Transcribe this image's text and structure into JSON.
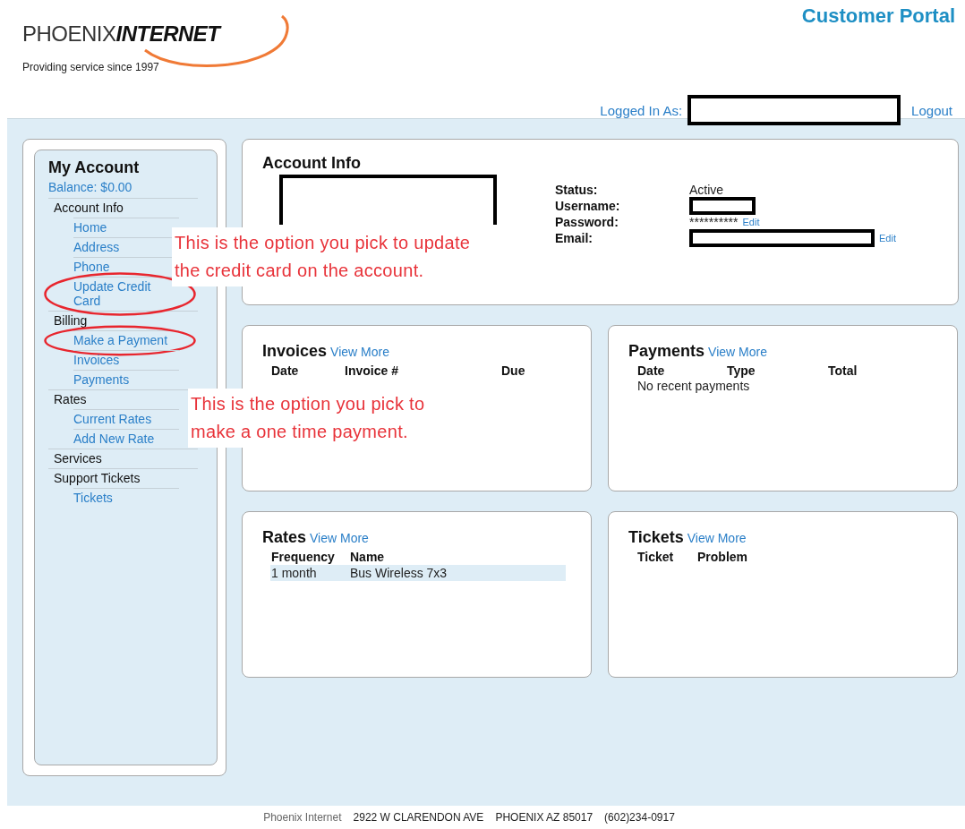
{
  "header": {
    "brand_light": "PHOENIX",
    "brand_bold": "INTERNET",
    "tagline": "Providing service since 1997",
    "portal_title": "Customer Portal"
  },
  "login": {
    "label": "Logged In As:",
    "logout": "Logout"
  },
  "sidebar": {
    "title": "My Account",
    "balance": "Balance: $0.00",
    "sections": [
      {
        "label": "Account Info",
        "children": [
          {
            "label": "Home",
            "circled": false
          },
          {
            "label": "Address",
            "circled": false
          },
          {
            "label": "Phone",
            "circled": false
          },
          {
            "label": "Update Credit Card",
            "circled": true
          }
        ]
      },
      {
        "label": "Billing",
        "children": [
          {
            "label": "Make a Payment",
            "circled": true
          },
          {
            "label": "Invoices",
            "circled": false
          },
          {
            "label": "Payments",
            "circled": false
          }
        ]
      },
      {
        "label": "Rates",
        "children": [
          {
            "label": "Current Rates",
            "circled": false
          },
          {
            "label": "Add New Rate",
            "circled": false
          }
        ]
      },
      {
        "label": "Services"
      },
      {
        "label": "Support Tickets",
        "children": [
          {
            "label": "Tickets",
            "circled": false
          }
        ]
      }
    ]
  },
  "account_info": {
    "title": "Account Info",
    "fields": [
      {
        "label": "Status:",
        "kind": "text",
        "value": "Active"
      },
      {
        "label": "Username:",
        "kind": "redacted"
      },
      {
        "label": "Password:",
        "kind": "text",
        "value": "**********",
        "action": "Edit"
      },
      {
        "label": "Email:",
        "kind": "redacted",
        "action": "Edit"
      }
    ]
  },
  "panels": [
    {
      "title": "Invoices",
      "link": "View More",
      "columns": [
        "Date",
        "Invoice #",
        "Due"
      ]
    },
    {
      "title": "Payments",
      "link": "View More",
      "columns": [
        "Date",
        "Type",
        "Total"
      ],
      "empty_text": "No recent payments"
    },
    {
      "title": "Rates",
      "link": "View More",
      "columns": [
        "Frequency",
        "Name"
      ],
      "rows": [
        [
          "1 month",
          "Bus Wireless 7x3"
        ]
      ]
    },
    {
      "title": "Tickets",
      "link": "View More",
      "columns": [
        "Ticket",
        "Problem"
      ]
    }
  ],
  "annotations": [
    "This is the option you pick to update the credit card on the account.",
    "This is the option you pick to make a one time payment."
  ],
  "footer": {
    "company": "Phoenix Internet",
    "address": "2922 W CLARENDON AVE",
    "city": "PHOENIX AZ 85017",
    "phone": "(602)234-0917"
  }
}
